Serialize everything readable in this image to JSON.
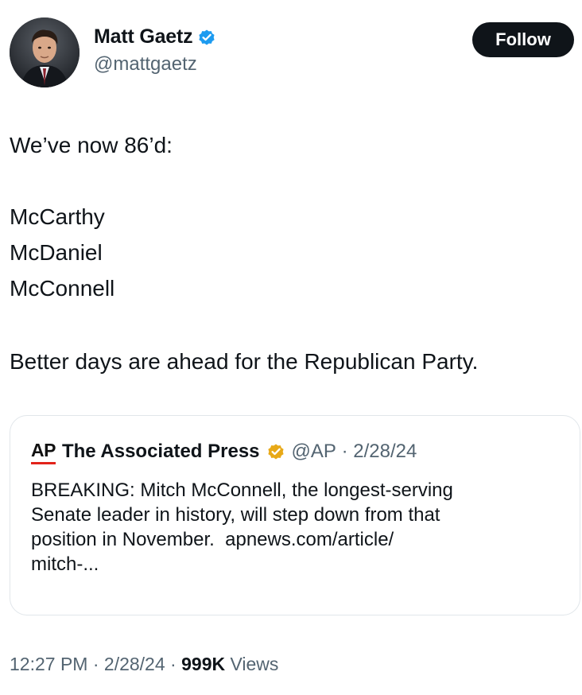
{
  "author": {
    "display_name": "Matt Gaetz",
    "handle": "@mattgaetz",
    "badge_icon": "verified-badge-blue",
    "badge_color": "#1d9bf0"
  },
  "follow_button": {
    "label": "Follow"
  },
  "tweet": {
    "intro": "We’ve now 86’d:",
    "list": [
      "McCarthy",
      "McDaniel",
      "McConnell"
    ],
    "closing": "Better days are ahead for the Republican Party."
  },
  "quote": {
    "logo_text": "AP",
    "logo_accent_color": "#e2231a",
    "name": "The Associated Press",
    "badge_icon": "verified-badge-gold",
    "badge_color": "#e8a917",
    "handle": "@AP",
    "separator": " · ",
    "date": "2/28/24",
    "lines": [
      "BREAKING: Mitch McConnell, the longest-serving",
      "Senate leader in history, will step down from that",
      "position in November.  apnews.com/article/",
      "mitch-..."
    ]
  },
  "footer": {
    "time": "12:27 PM",
    "sep1": " · ",
    "date": "2/28/24",
    "sep2": " · ",
    "views_count": "999K",
    "views_label": " Views"
  }
}
